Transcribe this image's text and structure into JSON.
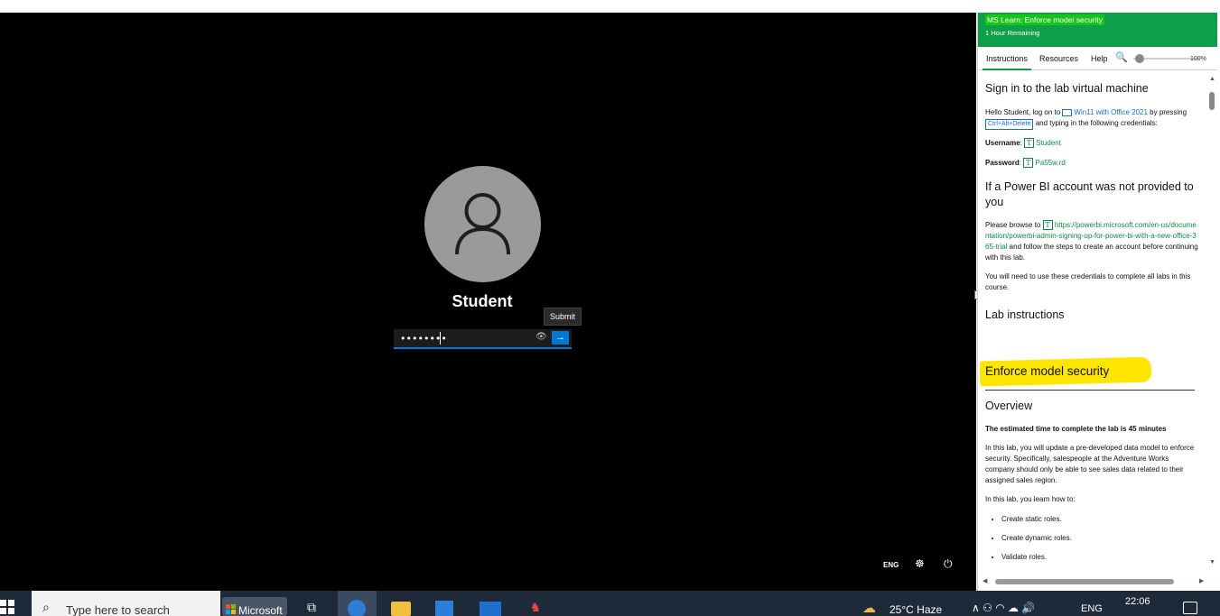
{
  "vm": {
    "username": "Student",
    "password_mask": "••••••••",
    "submit_tooltip": "Submit",
    "submit_arrow": "→",
    "eye_glyph": "👁",
    "lang": "ENG",
    "accessibility_glyph": "☸",
    "power_glyph": "⏻"
  },
  "panel": {
    "title": "MS Learn: Enforce model security",
    "remaining": "1 Hour Remaining",
    "tabs": {
      "instructions": "Instructions",
      "resources": "Resources",
      "help": "Help"
    },
    "zoom_icon": "🔍",
    "zoom_value": "100%",
    "sections": {
      "signin_heading": "Sign in to the lab virtual machine",
      "signin_p1_a": "Hello Student, log on to ",
      "vm_link": "Win11 with Office 2021",
      "signin_p1_b": " by pressing ",
      "kbd": "Ctrl+Alt+Delete",
      "signin_p1_c": " and typing in the following credentials:",
      "username_label": "Username",
      "username_value": "Student",
      "password_label": "Password",
      "password_value": "Pa55w.rd",
      "t_glyph": "T",
      "pbi_heading": "If a Power BI account was not provided to you",
      "pbi_p_a": "Please browse to ",
      "pbi_link": "https://powerbi.microsoft.com/en-us/documentation/powerbi-admin-signing-up-for-power-bi-with-a-new-office-365-trial",
      "pbi_p_b": " and follow the steps to create an account before continuing with this lab.",
      "pbi_p2": "You will need to use these credentials to complete all labs in this course.",
      "lab_heading": "Lab instructions",
      "lab_title": "Enforce model security",
      "overview_heading": "Overview",
      "overview_time": "The estimated time to complete the lab is 45 minutes",
      "overview_p1": "In this lab, you will update a pre-developed data model to enforce security. Specifically, salespeople at the Adventure Works company should only be able to see sales data related to their assigned sales region.",
      "overview_p2": "In this lab, you learn how to:",
      "bullets": [
        "Create static roles.",
        "Create dynamic roles.",
        "Validate roles."
      ]
    },
    "scroll_up": "▲",
    "scroll_down": "▼",
    "scroll_left": "◀",
    "scroll_right": "▶"
  },
  "taskbar": {
    "search_placeholder": "Type here to search",
    "search_icon": "⌕",
    "ms_app_label": "Microsoft",
    "taskview_glyph": "⧉",
    "game_glyph": "♞",
    "weather_glyph": "☁",
    "weather": "25°C  Haze",
    "tray": "∧  ⚇  ◠  ☁  🔊",
    "lang": "ENG",
    "time": "22:06"
  },
  "colors": {
    "header_green": "#0e9f4a",
    "link_green": "#0e8a3f",
    "link_blue": "#1b6fc2",
    "highlight_yellow": "#ffe600",
    "submit_blue": "#0078d4",
    "taskbar": "#1e2a3a"
  }
}
